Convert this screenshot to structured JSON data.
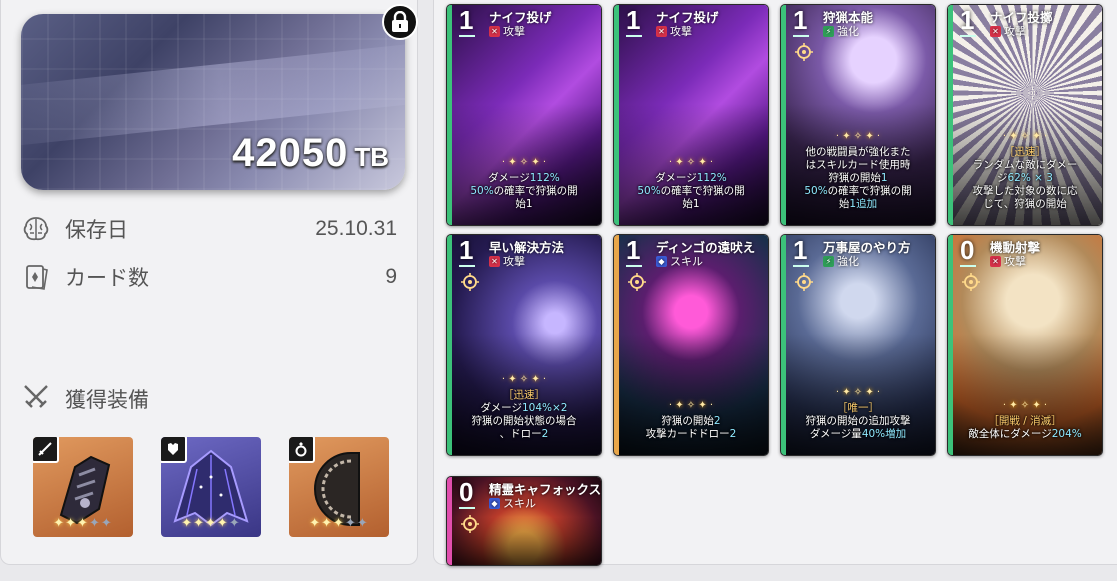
{
  "deck": {
    "balance": {
      "amount": "42050",
      "unit": "TB"
    },
    "info": [
      {
        "icon": "brain-icon",
        "label": "保存日",
        "value": "25.10.31"
      },
      {
        "icon": "card-stack-icon",
        "label": "カード数",
        "value": "9"
      }
    ],
    "equipment_title": "獲得装備",
    "equipment": [
      {
        "slot": "weapon",
        "slot_icon": "sword-icon",
        "name": "gauntlet",
        "stars_on": 3,
        "stars_total": 5,
        "bg": "#c97a45"
      },
      {
        "slot": "armor",
        "slot_icon": "armor-icon",
        "name": "cape",
        "stars_on": 4,
        "stars_total": 5,
        "bg": "#5b56a8"
      },
      {
        "slot": "accessory",
        "slot_icon": "ring-icon",
        "name": "shield",
        "stars_on": 3,
        "stars_total": 5,
        "bg": "#c97a45"
      }
    ]
  },
  "cards": [
    {
      "cost": "1",
      "name": "ナイフ投げ",
      "type": "攻撃",
      "type_kind": "attack",
      "desc_lines": [
        [
          "ダメージ",
          "112%"
        ],
        [
          "50%",
          "の確率で狩猟の開"
        ],
        [
          "始1",
          ""
        ]
      ],
      "theme": "purple",
      "strip": "#3cc27a"
    },
    {
      "cost": "1",
      "name": "ナイフ投げ",
      "type": "攻撃",
      "type_kind": "attack",
      "desc_lines": [
        [
          "ダメージ",
          "112%"
        ],
        [
          "50%",
          "の確率で狩猟の開"
        ],
        [
          "始1",
          ""
        ]
      ],
      "theme": "purple",
      "strip": "#3cc27a"
    },
    {
      "cost": "1",
      "name": "狩猟本能",
      "type": "強化",
      "type_kind": "buff",
      "desc_lines": [
        [
          "他の戦闘員が強化また",
          ""
        ],
        [
          "はスキルカード使用時",
          ""
        ],
        [
          "狩猟の開始",
          "1"
        ],
        [
          "50%",
          "の確率で狩猟の開"
        ],
        [
          "始",
          "1追加"
        ]
      ],
      "theme": "violet",
      "strip": "#3cc27a"
    },
    {
      "cost": "1",
      "name": "ナイフ投擲",
      "type": "攻撃",
      "type_kind": "attack",
      "tag": "［迅速］",
      "desc_lines": [
        [
          "ランダムな敵にダメー",
          ""
        ],
        [
          "ジ",
          "62% × 3"
        ],
        [
          "攻撃した対象の数に応",
          ""
        ],
        [
          "じて、狩猟の開始",
          ""
        ]
      ],
      "theme": "manga",
      "strip": "#3cc27a"
    },
    {
      "cost": "1",
      "name": "早い解決方法",
      "type": "攻撃",
      "type_kind": "attack",
      "tag": "［迅速］",
      "desc_lines": [
        [
          "ダメージ",
          "104%×2"
        ],
        [
          "狩猟の開始状態の場合",
          ""
        ],
        [
          "、ドロー",
          "2"
        ]
      ],
      "theme": "lightning",
      "strip": "#3cc27a"
    },
    {
      "cost": "1",
      "name": "ディンゴの遠吠え",
      "type": "スキル",
      "type_kind": "skill",
      "desc_lines": [
        [
          "狩猟の開始",
          "2"
        ],
        [
          "攻撃カードドロー",
          "2"
        ]
      ],
      "theme": "neon",
      "strip": "#e8a64a"
    },
    {
      "cost": "1",
      "name": "万事屋のやり方",
      "type": "強化",
      "type_kind": "buff",
      "tag": "［唯一］",
      "desc_lines": [
        [
          "狩猟の開始の追加攻撃",
          ""
        ],
        [
          "ダメージ量",
          "40%増加"
        ]
      ],
      "theme": "wolf",
      "strip": "#3cc27a"
    },
    {
      "cost": "0",
      "name": "機動射撃",
      "type": "攻撃",
      "type_kind": "attack",
      "tag": "［開戦 / 消滅］",
      "desc_lines": [
        [
          "敵全体にダメージ",
          "204%"
        ]
      ],
      "theme": "soldier",
      "strip": "#3cc27a"
    },
    {
      "cost": "0",
      "name": "精霊キャフォックス",
      "type": "スキル",
      "type_kind": "skill",
      "desc_lines": [],
      "theme": "fox",
      "strip": "#e24fae"
    }
  ],
  "colors": {
    "attack": "#d8314a",
    "buff": "#2f9e58",
    "skill": "#3b5bd6",
    "highlight": "#8fe9ff"
  }
}
